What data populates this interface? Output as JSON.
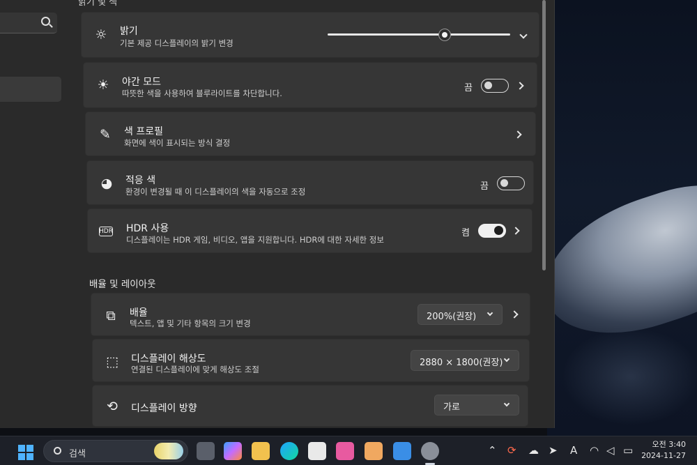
{
  "section_top": "밝기 및 색",
  "sidebar": {
    "search_icon": "search-icon"
  },
  "cards": {
    "brightness": {
      "title": "밝기",
      "subtitle": "기본 제공 디스플레이의 밝기 변경",
      "slider_value_percent": 64,
      "icon": "sun-icon"
    },
    "night_light": {
      "title": "야간 모드",
      "subtitle": "따뜻한 색을 사용하여 블루라이트를 차단합니다.",
      "state": "끔",
      "icon": "night-light-icon"
    },
    "color_profile": {
      "title": "색 프로필",
      "subtitle": "화면에 색이 표시되는 방식 결정",
      "icon": "color-picker-icon"
    },
    "adaptive_color": {
      "title": "적응 색",
      "subtitle": "환경이 변경될 때 이 디스플레이의 색을 자동으로 조정",
      "state": "끔",
      "icon": "palette-icon"
    },
    "hdr": {
      "title": "HDR 사용",
      "subtitle": "디스플레이는 HDR 게임, 비디오, 앱을 지원합니다.  HDR에 대한 자세한 정보",
      "state": "켬",
      "icon": "hdr-icon"
    }
  },
  "layout_section": {
    "title": "배율 및 레이아웃",
    "scale": {
      "title": "배율",
      "subtitle": "텍스트, 앱 및 기타 항목의 크기 변경",
      "value": "200%(권장)",
      "icon": "scale-icon"
    },
    "resolution": {
      "title": "디스플레이 해상도",
      "subtitle": "연결된 디스플레이에 맞게 해상도 조절",
      "value": "2880 × 1800(권장)",
      "icon": "resolution-icon"
    },
    "orientation": {
      "title": "디스플레이 방향",
      "value": "가로",
      "icon": "orientation-icon"
    }
  },
  "taskbar": {
    "search_placeholder": "검색",
    "clock_time": "오전 3:40",
    "clock_date": "2024-11-27",
    "ime": "A"
  },
  "colors": {
    "card": "#363636",
    "window": "#2a2a2a",
    "accent": "#4fb3ff"
  }
}
